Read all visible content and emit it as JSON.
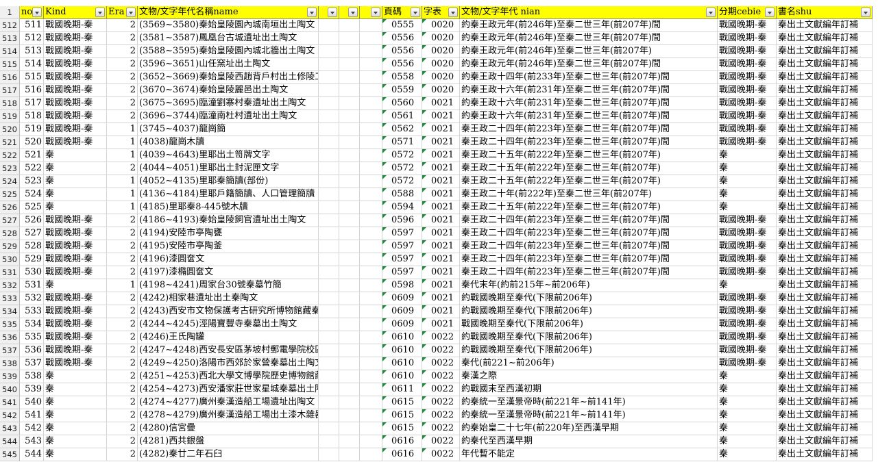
{
  "headers": {
    "rownum": "1",
    "no": "no",
    "kind": "Kind",
    "era": "Era",
    "name": "文物/文字年代名稱name",
    "blank1": "",
    "blank2": "",
    "blank3": "",
    "page": "頁碼",
    "code": "字表",
    "nian": "文物/文字年代 nian",
    "cebie": "分期cebie",
    "shu": "書名shu"
  },
  "rows": [
    [
      "512",
      "511",
      "戰國晚期-秦",
      "2",
      "(3569~3580)秦始皇陵園內城南垣出土陶文",
      "",
      "",
      "",
      "0555",
      "0020",
      "約秦王政元年(前246年)至秦二世三年(前207年)間",
      "戰國晚期-秦",
      "秦出土文獻編年訂補"
    ],
    [
      "513",
      "512",
      "戰國晚期-秦",
      "2",
      "(3581~3587)鳳凰台古城遺址出土陶文",
      "",
      "",
      "",
      "0556",
      "0020",
      "約秦王政元年(前246年)至秦二世三年(前207年)間",
      "戰國晚期-秦",
      "秦出土文獻編年訂補"
    ],
    [
      "514",
      "513",
      "戰國晚期-秦",
      "2",
      "(3588~3595)秦始皇陵園內城北牆出土陶文",
      "",
      "",
      "",
      "0556",
      "0020",
      "約秦王政元年(前246年)至秦二世三年(前207年)",
      "戰國晚期-秦",
      "秦出土文獻編年訂補"
    ],
    [
      "515",
      "514",
      "戰國晚期-秦",
      "2",
      "(3596~3651)山任窯址出土陶文",
      "",
      "",
      "",
      "0556",
      "0020",
      "約秦王政元年(前246年)至秦二世三年(前207年)間",
      "戰國晚期-秦",
      "秦出土文獻編年訂補"
    ],
    [
      "516",
      "515",
      "戰國晚期-秦",
      "2",
      "(3652~3669)秦始皇陵西趙背戶村出土修陵工人墓誌瓦文",
      "",
      "",
      "",
      "0558",
      "0020",
      "約秦王政十四年(前233年)至秦二世三年(前207年)間",
      "戰國晚期-秦",
      "秦出土文獻編年訂補"
    ],
    [
      "517",
      "516",
      "戰國晚期-秦",
      "2",
      "(3670~3674)秦始皇陵麗邑出土陶文",
      "",
      "",
      "",
      "0559",
      "0020",
      "約秦王政十六年(前231年)至秦二世三年(前207年)間",
      "戰國晚期-秦",
      "秦出土文獻編年訂補"
    ],
    [
      "518",
      "517",
      "戰國晚期-秦",
      "2",
      "(3675~3695)臨潼劉寨村秦遺址出土陶文",
      "",
      "",
      "",
      "0560",
      "0021",
      "約秦王政十六年(前231年)至秦二世三年(前207年)間",
      "戰國晚期-秦",
      "秦出土文獻編年訂補"
    ],
    [
      "519",
      "518",
      "戰國晚期-秦",
      "2",
      "(3696~3744)臨潼南杜村遺址出土陶文",
      "",
      "",
      "",
      "0561",
      "0021",
      "約秦王政十六年(前231年)至秦二世三年(前207年)間",
      "戰國晚期-秦",
      "秦出土文獻編年訂補"
    ],
    [
      "520",
      "519",
      "戰國晚期-秦",
      "1",
      "(3745~4037)龍崗簡",
      "",
      "",
      "",
      "0562",
      "0021",
      "秦王政二十四年(前223年)至秦二世三年(前207年)間",
      "戰國晚期-秦",
      "秦出土文獻編年訂補"
    ],
    [
      "521",
      "520",
      "戰國晚期-秦",
      "1",
      "(4038)龍崗木牘",
      "",
      "",
      "",
      "0571",
      "0021",
      "秦王政二十四年(前223年)至秦二世三年(前207年)間",
      "戰國晚期-秦",
      "秦出土文獻編年訂補"
    ],
    [
      "522",
      "521",
      "秦",
      "1",
      "(4039~4643)里耶出土笥牌文字",
      "",
      "",
      "",
      "0572",
      "0021",
      "秦王政二十五年(前222年)至秦二世三年(前207年)",
      "秦",
      "秦出土文獻編年訂補"
    ],
    [
      "523",
      "522",
      "秦",
      "2",
      "(4044~4051)里耶出土封泥匣文字",
      "",
      "",
      "",
      "0572",
      "0021",
      "秦王政二十五年(前222年)至秦二世三年(前207年)",
      "秦",
      "秦出土文獻編年訂補"
    ],
    [
      "524",
      "523",
      "秦",
      "1",
      "(4052~4135)里耶秦簡牘(部份)",
      "",
      "",
      "",
      "0572",
      "0021",
      "秦王政二十五年(前222年)至秦二世三年(前207年)",
      "秦",
      "秦出土文獻編年訂補"
    ],
    [
      "525",
      "524",
      "秦",
      "1",
      "(4136~4184)里耶戶籍簡牘、人口管理簡牘",
      "",
      "",
      "",
      "0588",
      "0021",
      "秦王政二十年(前222年)至秦二世三年(前207年)",
      "秦",
      "秦出土文獻編年訂補"
    ],
    [
      "526",
      "525",
      "秦",
      "1",
      "(4185)里耶秦8-445號木牘",
      "",
      "",
      "",
      "0594",
      "0021",
      "秦王政二十五年(前222年)至秦二世三年(前207年)",
      "秦",
      "秦出土文獻編年訂補"
    ],
    [
      "527",
      "526",
      "戰國晚期-秦",
      "2",
      "(4186~4193)秦始皇陵飼官遺址出土陶文",
      "",
      "",
      "",
      "0596",
      "0021",
      "秦王政二十四年(前223年)至秦二世三年(前207年)間",
      "戰國晚期-秦",
      "秦出土文獻編年訂補"
    ],
    [
      "528",
      "527",
      "戰國晚期-秦",
      "2",
      "(4194)安陸市亭陶甕",
      "",
      "",
      "",
      "0597",
      "0021",
      "秦王政二十四年(前223年)至秦二世三年(前207年)間",
      "戰國晚期-秦",
      "秦出土文獻編年訂補"
    ],
    [
      "529",
      "528",
      "戰國晚期-秦",
      "2",
      "(4195)安陸市亭陶釜",
      "",
      "",
      "",
      "0597",
      "0021",
      "秦王政二十四年(前223年)至秦二世三年(前207年)間",
      "戰國晚期-秦",
      "秦出土文獻編年訂補"
    ],
    [
      "530",
      "529",
      "戰國晚期-秦",
      "2",
      "(4196)漆圓奩文",
      "",
      "",
      "",
      "0597",
      "0021",
      "秦王政二十四年(前223年)至秦二世三年(前207年)間",
      "戰國晚期-秦",
      "秦出土文獻編年訂補"
    ],
    [
      "531",
      "530",
      "戰國晚期-秦",
      "2",
      "(4197)漆橢圓奩文",
      "",
      "",
      "",
      "0597",
      "0021",
      "秦王政二十四年(前223年)至秦二世三年(前207年)間",
      "戰國晚期-秦",
      "秦出土文獻編年訂補"
    ],
    [
      "532",
      "531",
      "秦",
      "1",
      "(4198~4241)周家台30號秦墓竹簡",
      "",
      "",
      "",
      "0598",
      "0021",
      "秦代末年(約前215年~前206年)",
      "秦",
      "秦出土文獻編年訂補"
    ],
    [
      "533",
      "532",
      "戰國晚期-秦",
      "2",
      "(4242)相家巷遺址出土秦陶文",
      "",
      "",
      "",
      "0609",
      "0021",
      "約戰國晚期至秦代(下限前206年)",
      "戰國晚期-秦",
      "秦出土文獻編年訂補"
    ],
    [
      "534",
      "533",
      "戰國晚期-秦",
      "2",
      "(4243)西安市文物保護考古研究所博物館藏秦陶文",
      "",
      "",
      "",
      "0609",
      "0021",
      "約戰國晚期至秦代(下限前206年)",
      "戰國晚期-秦",
      "秦出土文獻編年訂補"
    ],
    [
      "535",
      "534",
      "戰國晚期-秦",
      "2",
      "(4244~4245)涇陽寶豐寺秦墓出土陶文",
      "",
      "",
      "",
      "0609",
      "0021",
      "戰國晚期至秦代(下限前206年)",
      "戰國晚期-秦",
      "秦出土文獻編年訂補"
    ],
    [
      "536",
      "535",
      "戰國晚期-秦",
      "2",
      "(4246)王氏陶罐",
      "",
      "",
      "",
      "0610",
      "0022",
      "約戰國晚期至秦代(下限前206年)",
      "戰國晚期-秦",
      "秦出土文獻編年訂補"
    ],
    [
      "537",
      "536",
      "戰國晚期-秦",
      "2",
      "(4247~4248)西安長安區茅坡村郵電學院校區秦墓陶器",
      "",
      "",
      "",
      "0610",
      "0022",
      "約戰國晚期至秦代(下限前206年)",
      "戰國晚期-秦",
      "秦出土文獻編年訂補"
    ],
    [
      "538",
      "537",
      "戰國晚期-秦",
      "2",
      "(4249~4250)洛陽市西郊於家營秦墓出土陶文",
      "",
      "",
      "",
      "0610",
      "0022",
      "秦代(前221~前206年)",
      "戰國晚期-秦",
      "秦出土文獻編年訂補"
    ],
    [
      "539",
      "538",
      "秦",
      "2",
      "(4251~4253)西北大學文博學院歷史博物館藏秦陶文",
      "",
      "",
      "",
      "0610",
      "0022",
      "秦漢之際",
      "秦",
      "秦出土文獻編年訂補"
    ],
    [
      "540",
      "539",
      "秦",
      "2",
      "(4254~4273)西安潘家莊世家星城秦墓出土陶文",
      "",
      "",
      "",
      "0611",
      "0022",
      "約戰國末至西漢初期",
      "秦",
      "秦出土文獻編年訂補"
    ],
    [
      "541",
      "540",
      "秦",
      "2",
      "(4274~4277)廣州秦漢造船工場遺址出陶文",
      "",
      "",
      "",
      "0615",
      "0022",
      "約秦統一至漢景帝時(前221年~前141年)",
      "秦",
      "秦出土文獻編年訂補"
    ],
    [
      "542",
      "541",
      "秦",
      "2",
      "(4278~4279)廣州秦漢造船工場出土漆木雜器",
      "",
      "",
      "",
      "0615",
      "0022",
      "約秦統一至漢景帝時(前221年~前141年)",
      "秦",
      "秦出土文獻編年訂補"
    ],
    [
      "543",
      "542",
      "秦",
      "2",
      "(4280)信宮疊",
      "",
      "",
      "",
      "0615",
      "0022",
      "約秦始皇二十七年(前220年)至西漢早期",
      "秦",
      "秦出土文獻編年訂補"
    ],
    [
      "544",
      "543",
      "秦",
      "2",
      "(4281)西共銀盤",
      "",
      "",
      "",
      "0616",
      "0022",
      "約秦代至西漢早期",
      "秦",
      "秦出土文獻編年訂補"
    ],
    [
      "545",
      "544",
      "秦",
      "2",
      "(4282)秦廿二年石臼",
      "",
      "",
      "",
      "0616",
      "0022",
      "年代暫不能定",
      "秦",
      "秦出土文獻編年訂補"
    ]
  ]
}
